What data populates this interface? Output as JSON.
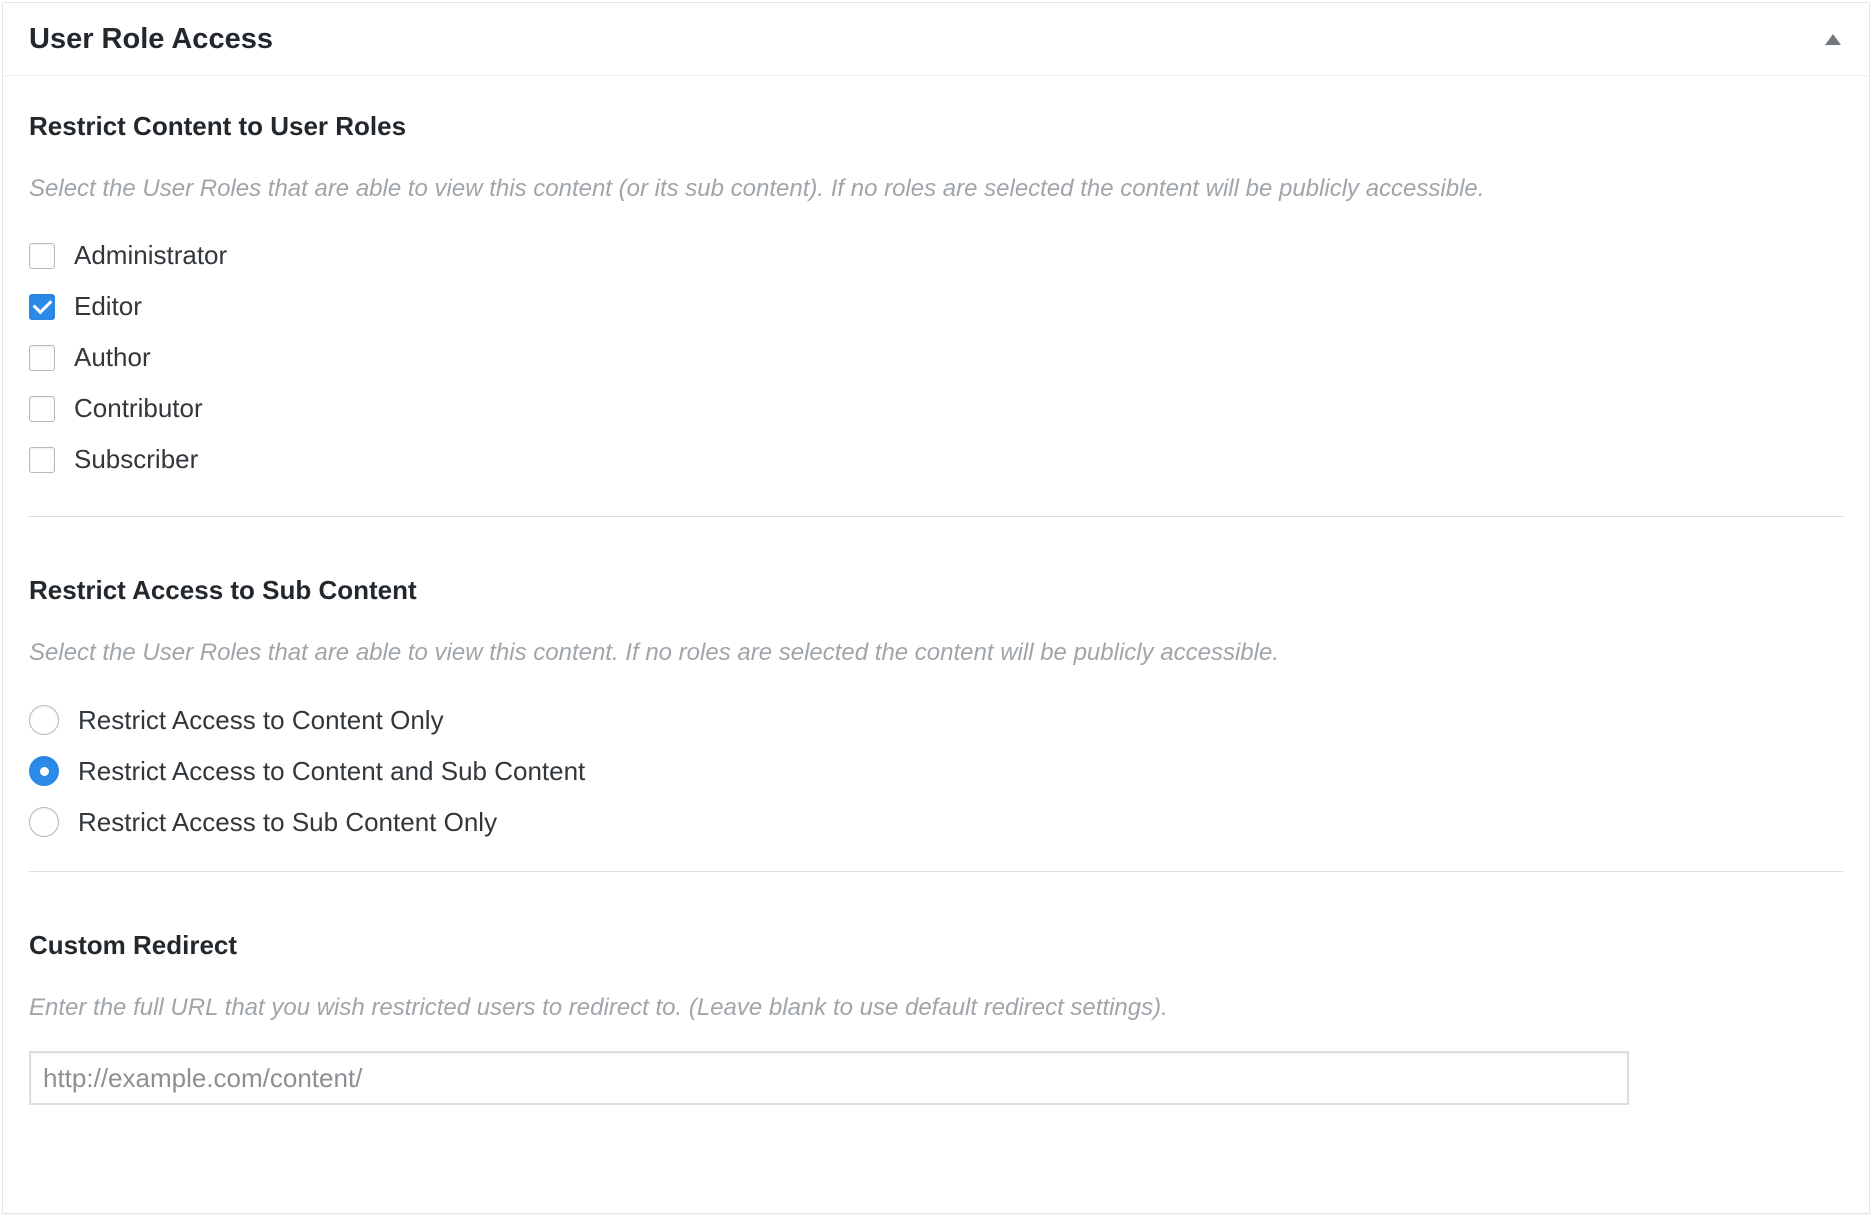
{
  "metabox": {
    "title": "User Role Access"
  },
  "restrict_content": {
    "title": "Restrict Content to User Roles",
    "description": "Select the User Roles that are able to view this content (or its sub content). If no roles are selected the content will be publicly accessible.",
    "roles": [
      {
        "label": "Administrator",
        "checked": false
      },
      {
        "label": "Editor",
        "checked": true
      },
      {
        "label": "Author",
        "checked": false
      },
      {
        "label": "Contributor",
        "checked": false
      },
      {
        "label": "Subscriber",
        "checked": false
      }
    ]
  },
  "sub_content": {
    "title": "Restrict Access to Sub Content",
    "description": "Select the User Roles that are able to view this content. If no roles are selected the content will be publicly accessible.",
    "options": [
      {
        "label": "Restrict Access to Content Only",
        "selected": false
      },
      {
        "label": "Restrict Access to Content and Sub Content",
        "selected": true
      },
      {
        "label": "Restrict Access to Sub Content Only",
        "selected": false
      }
    ]
  },
  "redirect": {
    "title": "Custom Redirect",
    "description": "Enter the full URL that you wish restricted users to redirect to. (Leave blank to use default redirect settings).",
    "placeholder": "http://example.com/content/",
    "value": ""
  },
  "colors": {
    "accent": "#2b8ae6",
    "description_text": "#a0a5aa",
    "heading_text": "#23282d"
  },
  "icons": {
    "collapse": "triangle-up-icon",
    "checkmark": "checkmark-icon"
  }
}
